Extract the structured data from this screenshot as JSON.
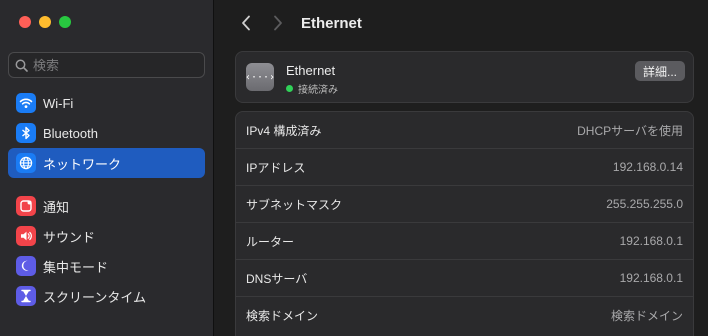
{
  "window": {
    "traffic_lights": {
      "close_color": "#fe5f57",
      "minimize_color": "#febc2e",
      "maximize_color": "#28c840"
    }
  },
  "sidebar": {
    "search": {
      "placeholder": "検索"
    },
    "items": [
      {
        "label": "Wi-Fi",
        "icon": "wifi-icon",
        "color": "#1a7cf5",
        "active": false
      },
      {
        "label": "Bluetooth",
        "icon": "bluetooth-icon",
        "color": "#1a7cf5",
        "active": false
      },
      {
        "label": "ネットワーク",
        "icon": "globe-icon",
        "color": "#1a7cf5",
        "active": true
      },
      {
        "label": "通知",
        "icon": "bell-icon",
        "color": "#f2444a",
        "active": false
      },
      {
        "label": "サウンド",
        "icon": "speaker-icon",
        "color": "#f2444a",
        "active": false
      },
      {
        "label": "集中モード",
        "icon": "moon-icon",
        "color": "#5e5ce6",
        "active": false
      },
      {
        "label": "スクリーンタイム",
        "icon": "hourglass-icon",
        "color": "#5e5ce6",
        "active": false
      }
    ],
    "accent": "#1f5cbf"
  },
  "toolbar": {
    "title": "Ethernet"
  },
  "connection": {
    "name": "Ethernet",
    "status": "接続済み",
    "status_color": "#30d158",
    "details_label": "詳細...",
    "icon_glyph": "‹···›"
  },
  "info_rows": [
    {
      "label": "IPv4 構成済み",
      "value": "DHCPサーバを使用"
    },
    {
      "label": "IPアドレス",
      "value": "192.168.0.14"
    },
    {
      "label": "サブネットマスク",
      "value": "255.255.255.0"
    },
    {
      "label": "ルーター",
      "value": "192.168.0.1"
    },
    {
      "label": "DNSサーバ",
      "value": "192.168.0.1"
    },
    {
      "label": "検索ドメイン",
      "value": "検索ドメイン"
    }
  ]
}
